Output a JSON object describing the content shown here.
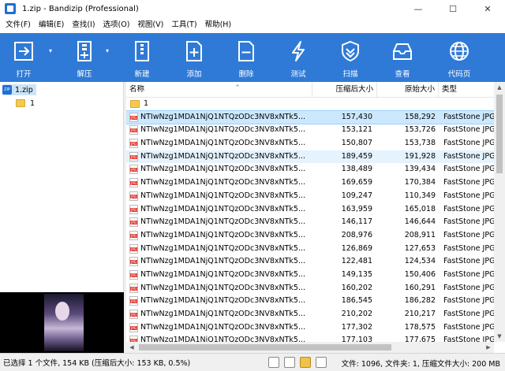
{
  "window": {
    "title": "1.zip - Bandizip (Professional)",
    "minimize": "—",
    "maximize": "☐",
    "close": "✕"
  },
  "menu": [
    "文件(F)",
    "编辑(E)",
    "查找(I)",
    "选项(O)",
    "视图(V)",
    "工具(T)",
    "帮助(H)"
  ],
  "toolbar": {
    "open": "打开",
    "extract": "解压",
    "new": "新建",
    "add": "添加",
    "delete": "删除",
    "test": "测试",
    "scan": "扫描",
    "view": "查看",
    "codepage": "代码页"
  },
  "tree": {
    "root": "1.zip",
    "child": "1"
  },
  "columns": {
    "name": "名称",
    "compressed": "压缩后大小",
    "original": "原始大小",
    "type": "类型"
  },
  "folder_row": {
    "name": "1"
  },
  "files": [
    {
      "name": "NTIwNzg1MDA1NjQ1NTQzODc3NV8xNTk5...",
      "compressed": "157,430",
      "original": "158,292",
      "type": "FastStone JPG"
    },
    {
      "name": "NTIwNzg1MDA1NjQ1NTQzODc3NV8xNTk5...",
      "compressed": "153,121",
      "original": "153,726",
      "type": "FastStone JPG"
    },
    {
      "name": "NTIwNzg1MDA1NjQ1NTQzODc3NV8xNTk5...",
      "compressed": "150,807",
      "original": "153,738",
      "type": "FastStone JPG"
    },
    {
      "name": "NTIwNzg1MDA1NjQ1NTQzODc3NV8xNTk5...",
      "compressed": "189,459",
      "original": "191,928",
      "type": "FastStone JPG"
    },
    {
      "name": "NTIwNzg1MDA1NjQ1NTQzODc3NV8xNTk5...",
      "compressed": "138,489",
      "original": "139,434",
      "type": "FastStone JPG"
    },
    {
      "name": "NTIwNzg1MDA1NjQ1NTQzODc3NV8xNTk5...",
      "compressed": "169,659",
      "original": "170,384",
      "type": "FastStone JPG"
    },
    {
      "name": "NTIwNzg1MDA1NjQ1NTQzODc3NV8xNTk5...",
      "compressed": "109,247",
      "original": "110,349",
      "type": "FastStone JPG"
    },
    {
      "name": "NTIwNzg1MDA1NjQ1NTQzODc3NV8xNTk5...",
      "compressed": "163,959",
      "original": "165,018",
      "type": "FastStone JPG"
    },
    {
      "name": "NTIwNzg1MDA1NjQ1NTQzODc3NV8xNTk5...",
      "compressed": "146,117",
      "original": "146,644",
      "type": "FastStone JPG"
    },
    {
      "name": "NTIwNzg1MDA1NjQ1NTQzODc3NV8xNTk5...",
      "compressed": "208,976",
      "original": "208,911",
      "type": "FastStone JPG"
    },
    {
      "name": "NTIwNzg1MDA1NjQ1NTQzODc3NV8xNTk5...",
      "compressed": "126,869",
      "original": "127,653",
      "type": "FastStone JPG"
    },
    {
      "name": "NTIwNzg1MDA1NjQ1NTQzODc3NV8xNTk5...",
      "compressed": "122,481",
      "original": "124,534",
      "type": "FastStone JPG"
    },
    {
      "name": "NTIwNzg1MDA1NjQ1NTQzODc3NV8xNTk5...",
      "compressed": "149,135",
      "original": "150,406",
      "type": "FastStone JPG"
    },
    {
      "name": "NTIwNzg1MDA1NjQ1NTQzODc3NV8xNTk5...",
      "compressed": "160,202",
      "original": "160,291",
      "type": "FastStone JPG"
    },
    {
      "name": "NTIwNzg1MDA1NjQ1NTQzODc3NV8xNTk5...",
      "compressed": "186,545",
      "original": "186,282",
      "type": "FastStone JPG"
    },
    {
      "name": "NTIwNzg1MDA1NjQ1NTQzODc3NV8xNTk5...",
      "compressed": "210,202",
      "original": "210,217",
      "type": "FastStone JPG"
    },
    {
      "name": "NTIwNzg1MDA1NjQ1NTQzODc3NV8xNTk5...",
      "compressed": "177,302",
      "original": "178,575",
      "type": "FastStone JPG"
    },
    {
      "name": "NTIwNzg1MDA1NjQ1NTQzODc3NV8xNTk5...",
      "compressed": "177,103",
      "original": "177,675",
      "type": "FastStone JPG"
    }
  ],
  "status": {
    "left": "已选择 1 个文件, 154 KB (压缩后大小: 153 KB, 0.5%)",
    "right": "文件: 1096, 文件夹: 1, 压缩文件大小: 200 MB"
  },
  "colors": {
    "toolbar": "#2f7ad6",
    "selection": "#cce8ff"
  }
}
